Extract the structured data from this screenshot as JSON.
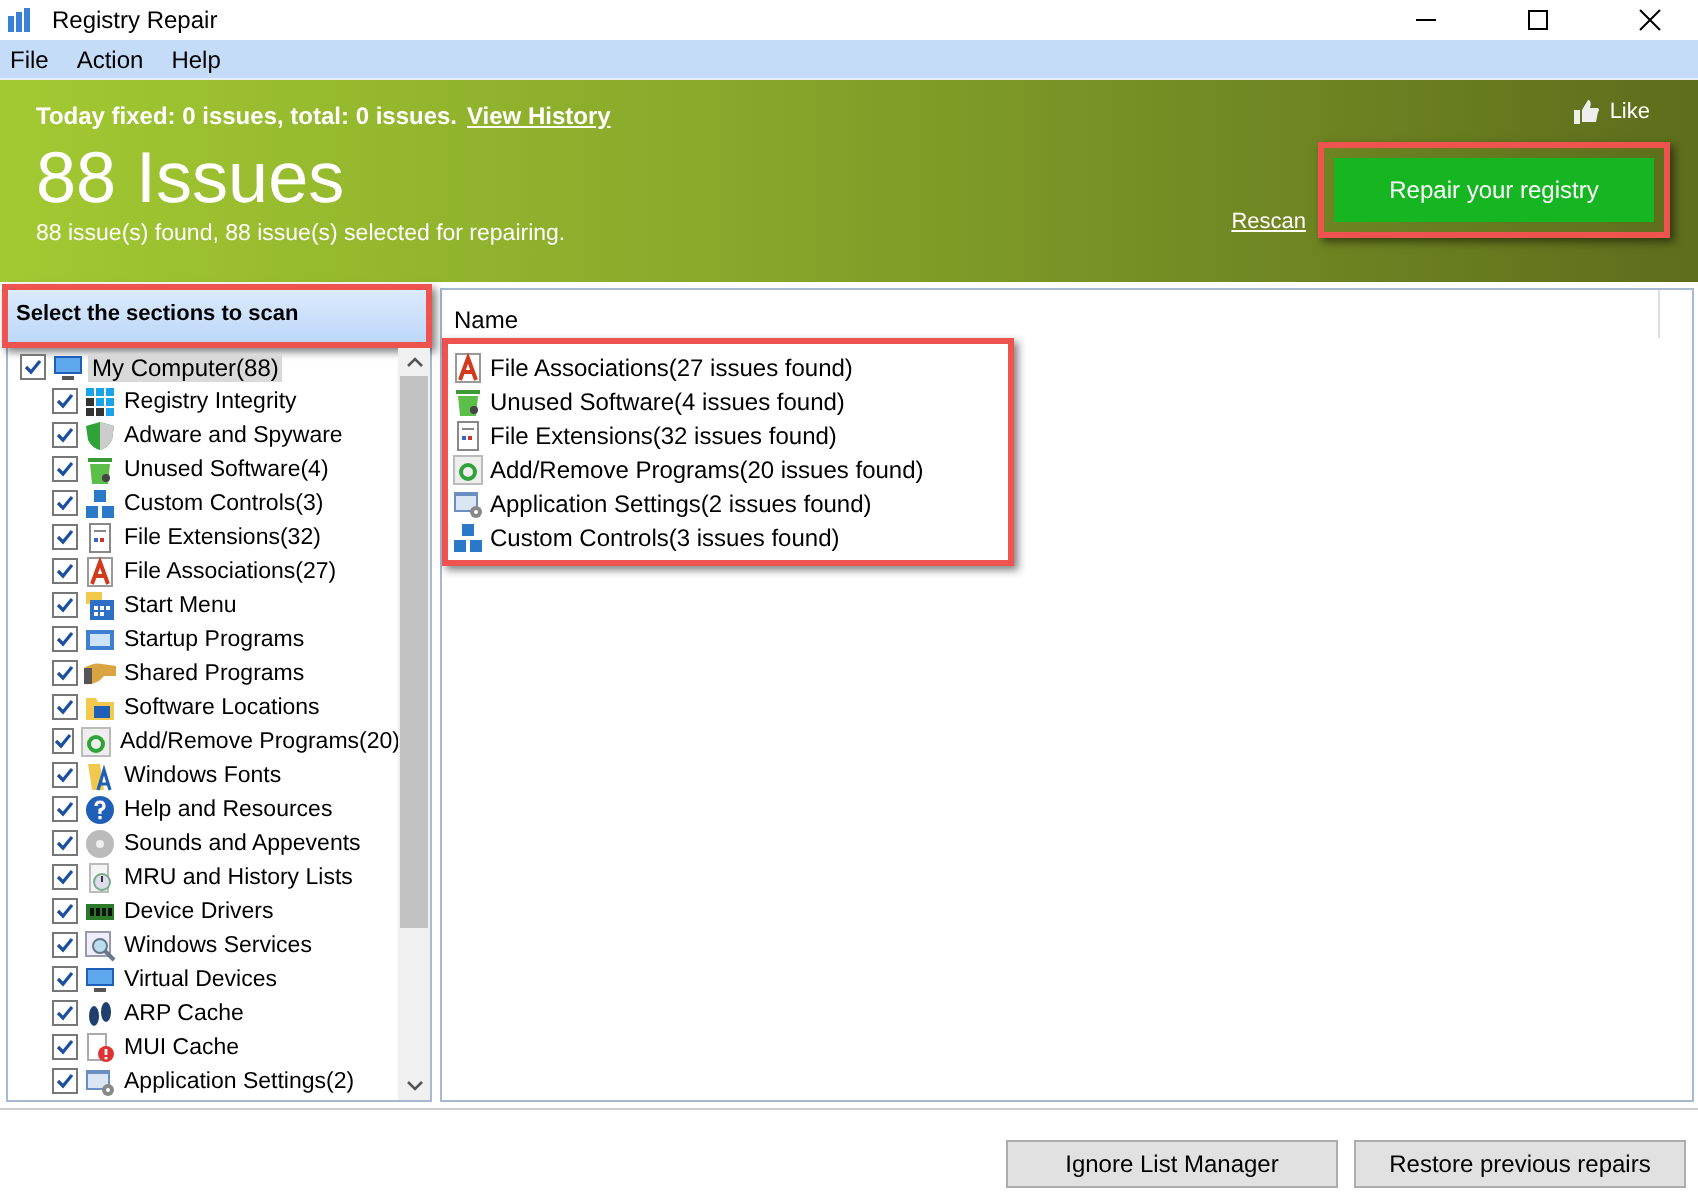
{
  "window": {
    "title": "Registry Repair"
  },
  "menu": [
    "File",
    "Action",
    "Help"
  ],
  "header": {
    "today": "Today fixed: 0 issues, total: 0 issues.",
    "history_link": "View History",
    "issues": "88 Issues",
    "summary": "88 issue(s) found, 88 issue(s) selected for repairing.",
    "like": "Like",
    "rescan": "Rescan",
    "repair_button": {
      "label": "Repair your registry",
      "highlighted": true
    }
  },
  "sections_panel": {
    "title": "Select the sections to scan",
    "highlighted": true
  },
  "tree": {
    "label": "My Computer(88)",
    "kind": "monitor",
    "checked": true,
    "selected": true,
    "children": [
      {
        "label": "Registry Integrity",
        "kind": "grid",
        "checked": true
      },
      {
        "label": "Adware and Spyware",
        "kind": "shield",
        "checked": true
      },
      {
        "label": "Unused Software(4)",
        "kind": "bin",
        "checked": true
      },
      {
        "label": "Custom Controls(3)",
        "kind": "blocks",
        "checked": true
      },
      {
        "label": "File Extensions(32)",
        "kind": "page",
        "checked": true
      },
      {
        "label": "File Associations(27)",
        "kind": "letter",
        "checked": true
      },
      {
        "label": "Start Menu",
        "kind": "calendar",
        "checked": true
      },
      {
        "label": "Startup Programs",
        "kind": "window",
        "checked": true
      },
      {
        "label": "Shared Programs",
        "kind": "hand",
        "checked": true
      },
      {
        "label": "Software Locations",
        "kind": "folder",
        "checked": true
      },
      {
        "label": "Add/Remove Programs(20)",
        "kind": "recycle",
        "checked": true
      },
      {
        "label": "Windows Fonts",
        "kind": "font",
        "checked": true
      },
      {
        "label": "Help and Resources",
        "kind": "help",
        "checked": true
      },
      {
        "label": "Sounds and Appevents",
        "kind": "disc",
        "checked": true
      },
      {
        "label": "MRU and History Lists",
        "kind": "clock",
        "checked": true
      },
      {
        "label": "Device Drivers",
        "kind": "chip",
        "checked": true
      },
      {
        "label": "Windows Services",
        "kind": "magnifier",
        "checked": true
      },
      {
        "label": "Virtual Devices",
        "kind": "monitor",
        "checked": true
      },
      {
        "label": "ARP Cache",
        "kind": "feet",
        "checked": true
      },
      {
        "label": "MUI Cache",
        "kind": "warning",
        "checked": true
      },
      {
        "label": "Application Settings(2)",
        "kind": "settings",
        "checked": true
      }
    ]
  },
  "results": {
    "columns": [
      "Name"
    ],
    "highlighted": true,
    "rows": [
      {
        "label": "File Associations(27 issues found)",
        "kind": "letter"
      },
      {
        "label": "Unused Software(4 issues found)",
        "kind": "bin"
      },
      {
        "label": "File Extensions(32 issues found)",
        "kind": "page"
      },
      {
        "label": "Add/Remove Programs(20 issues found)",
        "kind": "recycle"
      },
      {
        "label": "Application Settings(2 issues found)",
        "kind": "settings"
      },
      {
        "label": "Custom Controls(3 issues found)",
        "kind": "blocks"
      }
    ]
  },
  "footer_buttons": [
    "Ignore List Manager",
    "Restore previous repairs"
  ]
}
